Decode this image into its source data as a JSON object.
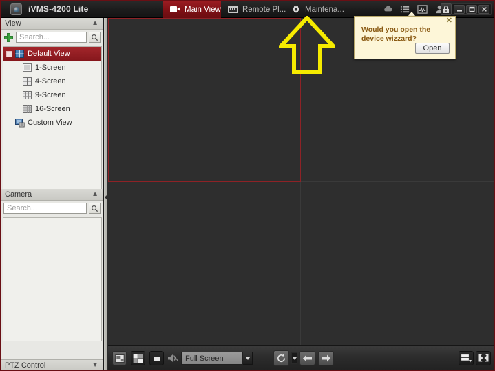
{
  "window": {
    "app_title": "iVMS-4200 Lite",
    "logo_icon": "camera-logo-icon",
    "controls": {
      "minimize": "minimize-icon",
      "restore": "restore-icon",
      "close": "close-icon"
    }
  },
  "tabs": [
    {
      "label": "Main View",
      "icon": "video-camera-icon",
      "active": true
    },
    {
      "label": "Remote Pl...",
      "icon": "film-strip-icon",
      "active": false
    },
    {
      "label": "Maintena...",
      "icon": "gear-icon",
      "active": false
    }
  ],
  "system_icons": [
    {
      "name": "cloud-icon"
    },
    {
      "name": "list-menu-icon"
    },
    {
      "name": "activity-chart-icon"
    },
    {
      "name": "user-account-icon"
    },
    {
      "name": "lock-icon"
    }
  ],
  "sidebar": {
    "view_panel": {
      "title": "View",
      "collapse_icon": "chevron-up-icon",
      "add_button": "add-view-button",
      "search_placeholder": "Search...",
      "search_icon": "magnifier-icon",
      "tree": [
        {
          "label": "Default View",
          "icon": "grid-view-icon",
          "level": 0,
          "selected": true,
          "expander": true
        },
        {
          "label": "1-Screen",
          "icon": "screen-1-icon",
          "level": 1,
          "selected": false,
          "expander": false
        },
        {
          "label": "4-Screen",
          "icon": "screen-4-icon",
          "level": 1,
          "selected": false,
          "expander": false
        },
        {
          "label": "9-Screen",
          "icon": "screen-9-icon",
          "level": 1,
          "selected": false,
          "expander": false
        },
        {
          "label": "16-Screen",
          "icon": "screen-16-icon",
          "level": 1,
          "selected": false,
          "expander": false
        },
        {
          "label": "Custom View",
          "icon": "custom-view-icon",
          "level": 0,
          "selected": false,
          "expander": false
        }
      ]
    },
    "camera_panel": {
      "title": "Camera",
      "collapse_icon": "chevron-up-icon",
      "search_placeholder": "Search...",
      "search_icon": "magnifier-icon",
      "items": []
    },
    "ptz_panel": {
      "title": "PTZ Control",
      "expand_icon": "chevron-down-icon"
    }
  },
  "video": {
    "pane_count": 4,
    "selected_pane_index": 0,
    "selection_color": "#8e2226",
    "background_color": "#2e2e2e"
  },
  "cursor": {
    "name": "yellow-arrow-pointer",
    "color": "#f5ea00",
    "direction": "up"
  },
  "toolbar": {
    "capture_button": "capture-picture-button",
    "layout_button": "window-division-button",
    "stop_button": "stop-all-live-view-button",
    "audio_button": "mute-audio-button",
    "screen_mode_value": "Full Screen",
    "screen_mode_arrow": "chevron-down-icon",
    "refresh_button": "refresh-button",
    "refresh_dropdown": "chevron-down-icon",
    "previous_button": "previous-page-button",
    "next_button": "next-page-button",
    "layout_right_button": "layout-selector-button",
    "fullscreen_button": "fullscreen-button"
  },
  "popup": {
    "message": "Would you open the device wizzard?",
    "open_label": "Open",
    "close_icon": "close-icon",
    "background_color": "#fdf6d8",
    "text_color": "#8a5a13"
  }
}
